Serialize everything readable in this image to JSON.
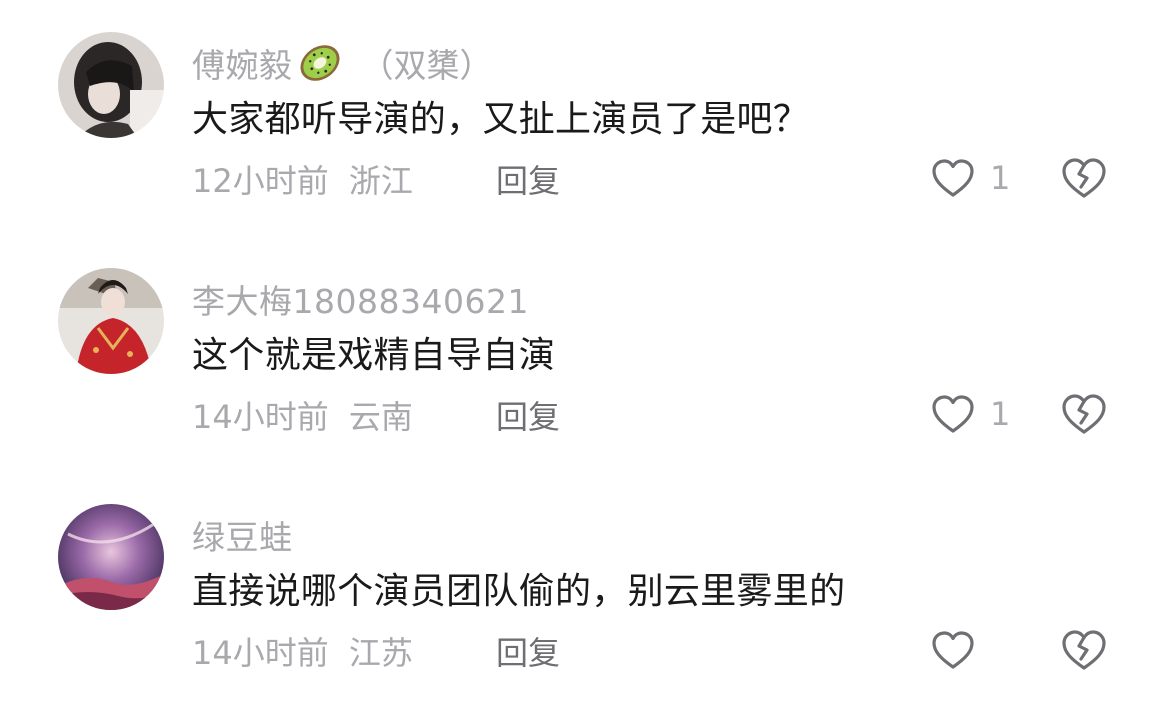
{
  "comments": [
    {
      "username": "傅婉毅",
      "badge_icon": "kiwi-emoji",
      "tag": "（双橥）",
      "text": "大家都听导演的，又扯上演员了是吧？",
      "time": "12小时前",
      "location": "浙江",
      "reply_label": "回复",
      "like_count": "1"
    },
    {
      "username": "李大梅18088340621",
      "text": "这个就是戏精自导自演",
      "time": "14小时前",
      "location": "云南",
      "reply_label": "回复",
      "like_count": "1"
    },
    {
      "username": "绿豆蛙",
      "text": "直接说哪个演员团队偷的，别云里雾里的",
      "time": "14小时前",
      "location": "江苏",
      "reply_label": "回复",
      "like_count": ""
    }
  ],
  "colors": {
    "username": "#a8a8ad",
    "text": "#1a1a1a",
    "meta": "#a8a8ad",
    "reply": "#6e6e73",
    "icon_stroke": "#6e6e73"
  },
  "icons": {
    "like": "heart-outline-icon",
    "dislike": "broken-heart-icon"
  }
}
